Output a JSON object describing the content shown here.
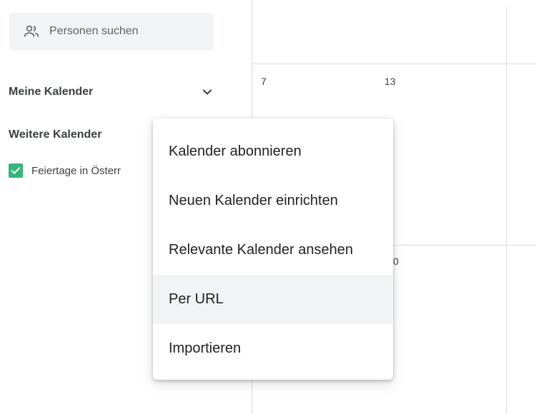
{
  "sidebar": {
    "search_placeholder": "Personen suchen",
    "search_icon": "people-icon",
    "my_calendars_label": "Meine Kalender",
    "other_calendars_label": "Weitere Kalender",
    "calendar_items": [
      {
        "label": "Feiertage in Österr",
        "checked": true,
        "color": "#33b679"
      }
    ]
  },
  "grid": {
    "day_numbers": [
      "7",
      "13",
      "0"
    ]
  },
  "menu": {
    "items": [
      {
        "label": "Kalender abonnieren"
      },
      {
        "label": "Neuen Kalender einrichten"
      },
      {
        "label": "Relevante Kalender ansehen"
      },
      {
        "label": "Per URL",
        "highlighted": true
      },
      {
        "label": "Importieren"
      }
    ]
  }
}
